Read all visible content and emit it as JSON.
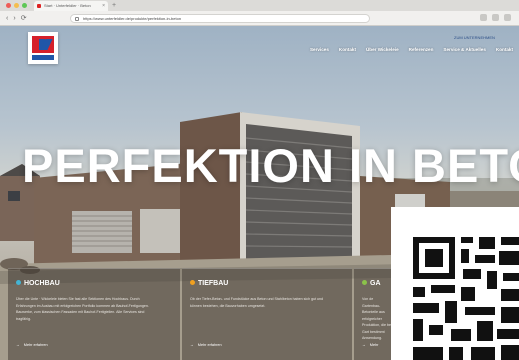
{
  "browser": {
    "tab_title": "Start · Unterfeldler · Beton",
    "tab_close": "×",
    "new_tab": "+",
    "nav_buttons": [
      "‹",
      "›",
      "⟳"
    ],
    "url": "https://www.unterfeldler.de/produkte/perfektion-in-beton"
  },
  "header": {
    "top_link": "ZUM UNTERNEHMEN",
    "nav": [
      "Services",
      "Kontakt",
      "Über Wickeleie",
      "Referenzen",
      "Service & Aktuelles",
      "Kontakt"
    ]
  },
  "hero": {
    "headline": "PERFEKTION IN BETON"
  },
  "cards": [
    {
      "title": "HOCHBAU",
      "accent": "#44b4d4",
      "body": "Über die Unte · Wickeleie bieten Sie fast alle Sektionen des Hochbaus. Durch Erfahrungen im Ausbau mit erfolgreichen Portfolio kommen ab Bauhof-Fertigungen. Bauwerke, zum klassischen Fassaden mit Bauhof-Fertigteilen. Alle Services sind tragfähig.",
      "more": "Mehr erfahren"
    },
    {
      "title": "TIEFBAU",
      "accent": "#f0a020",
      "body": "Ob der Tiefer-Beton- und Fundstücke aus Beton und Stahlbeton haben sich gut und können bestehen, die Bauvorhaben umgesetzt.",
      "more": "Mehr erfahren"
    },
    {
      "title": "GA",
      "accent": "#8bc24a",
      "body": "Von de Gartenbau-Betonteile aus erfolgreicher Produktion, die bei Gart bestimmt Anwendung.",
      "more": "Mehr"
    }
  ],
  "colors": {
    "brand_red": "#d5202a",
    "brand_blue": "#1f56a8"
  }
}
